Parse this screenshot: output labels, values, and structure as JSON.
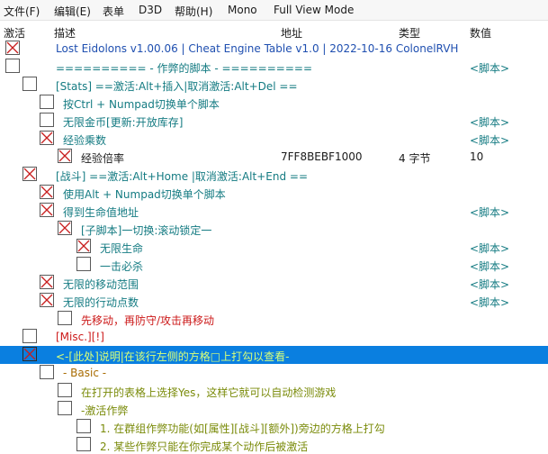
{
  "menu": [
    "文件(F)",
    "编辑(E)",
    "表单",
    "D3D",
    "帮助(H)",
    "Mono",
    "Full View Mode"
  ],
  "columns": {
    "active": "激活",
    "description": "描述",
    "address": "地址",
    "type": "类型",
    "value": "数值"
  },
  "rows": [
    {
      "checked": true,
      "description": "Lost Eidolons v1.00.06 | Cheat Engine Table v1.0 | 2022-10-16 ColonelRVH",
      "value": ""
    },
    {
      "checked": false,
      "description": "========== - 作弊的脚本 -         ==========",
      "value": "<脚本>"
    },
    {
      "checked": false,
      "description": "[Stats] ==激活:Alt+插入|取消激活:Alt+Del ==",
      "value": ""
    },
    {
      "checked": false,
      "description": "按Ctrl + Numpad切换单个脚本",
      "value": ""
    },
    {
      "checked": false,
      "description": "无限金币[更新:开放库存]",
      "value": "<脚本>"
    },
    {
      "checked": true,
      "description": "经验乘数",
      "value": "<脚本>"
    },
    {
      "checked": true,
      "description": "经验倍率",
      "address": "7FF8BEBF1000",
      "type": "4 字节",
      "value": "10"
    },
    {
      "checked": true,
      "description": "[战斗] ==激活:Alt+Home |取消激活:Alt+End ==",
      "value": ""
    },
    {
      "checked": true,
      "description": "使用Alt + Numpad切换单个脚本",
      "value": ""
    },
    {
      "checked": true,
      "description": "得到生命值地址",
      "value": "<脚本>"
    },
    {
      "checked": true,
      "description": "[子脚本]一切换:滚动锁定一",
      "value": ""
    },
    {
      "checked": true,
      "description": "无限生命",
      "value": "<脚本>"
    },
    {
      "checked": false,
      "description": "一击必杀",
      "value": "<脚本>"
    },
    {
      "checked": true,
      "description": "无限的移动范围",
      "value": "<脚本>"
    },
    {
      "checked": true,
      "description": "无限的行动点数",
      "value": "<脚本>"
    },
    {
      "checked": false,
      "description": "先移动，再防守/攻击再移动",
      "value": ""
    },
    {
      "checked": false,
      "description": "[Misc.][!]",
      "value": ""
    },
    {
      "checked": true,
      "description": "<-[此处]说明|在该行左侧的方格□上打勾以查看-",
      "value": ""
    },
    {
      "checked": false,
      "description": "- Basic -",
      "value": ""
    },
    {
      "checked": false,
      "description": "在打开的表格上选择Yes，这样它就可以自动检测游戏",
      "value": ""
    },
    {
      "checked": false,
      "description": "-激活作弊",
      "value": ""
    },
    {
      "checked": false,
      "description": "1. 在群组作弊功能(如[属性][战斗][额外])旁边的方格上打勾",
      "value": ""
    },
    {
      "checked": false,
      "description": "2. 某些作弊只能在你完成某个动作后被激活",
      "value": ""
    }
  ]
}
